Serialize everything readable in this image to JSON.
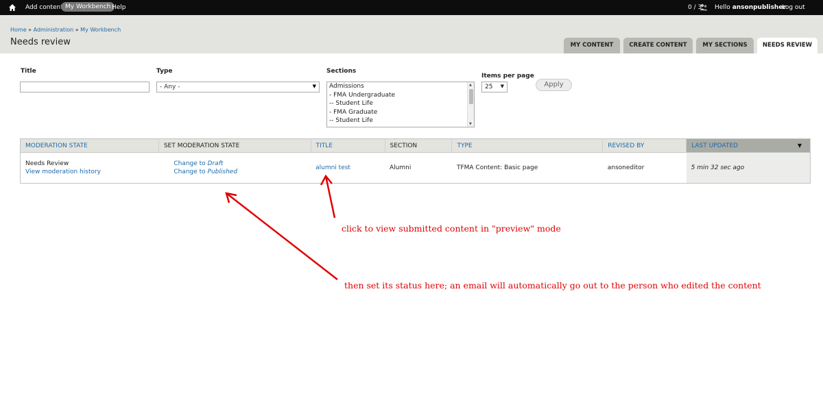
{
  "toolbar": {
    "add_content": "Add content",
    "my_workbench": "My Workbench",
    "help": "Help",
    "user_count": "0 / 3",
    "hello": "Hello",
    "username": "ansonpublisher",
    "logout": "Log out"
  },
  "breadcrumb": {
    "home": "Home",
    "sep": "»",
    "administration": "Administration",
    "my_workbench": "My Workbench"
  },
  "page_title": "Needs review",
  "tabs": [
    {
      "label": "MY CONTENT"
    },
    {
      "label": "CREATE CONTENT"
    },
    {
      "label": "MY SECTIONS"
    },
    {
      "label": "NEEDS REVIEW",
      "active": true
    }
  ],
  "filters": {
    "title_label": "Title",
    "title_value": "",
    "type_label": "Type",
    "type_value": "- Any -",
    "sections_label": "Sections",
    "sections_options": [
      "Admissions",
      "- FMA Undergraduate",
      "-- Student Life",
      "- FMA Graduate",
      "-- Student Life"
    ],
    "ipp_label": "Items per page",
    "ipp_value": "25",
    "apply_label": "Apply"
  },
  "table": {
    "headers": {
      "moderation_state": "MODERATION STATE",
      "set_moderation_state": "SET MODERATION STATE",
      "title": "TITLE",
      "section": "SECTION",
      "type": "TYPE",
      "revised_by": "REVISED BY",
      "last_updated": "LAST UPDATED"
    },
    "row": {
      "state": "Needs Review",
      "history_link": "View moderation history",
      "change_to": "Change to",
      "draft": "Draft",
      "published": "Published",
      "title": "alumni test",
      "section": "Alumni",
      "type": "TFMA Content: Basic page",
      "revised_by": "ansoneditor",
      "last_updated": "5 min 32 sec ago"
    }
  },
  "annotations": {
    "note1": "click to view submitted content in \"preview\" mode",
    "note2": "then set its status here; an email will automatically go out to the person who edited the content",
    "color": "#e00000"
  },
  "colors": {
    "toolbar_bg": "#0d0d0d",
    "header_bg": "#e3e3df",
    "link": "#1e6aa8",
    "tab_bg": "#b9b9b4"
  }
}
